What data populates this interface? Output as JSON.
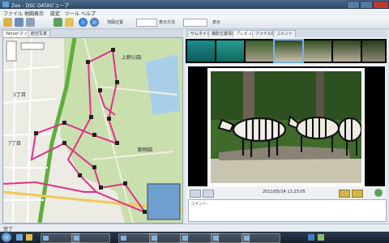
{
  "window": {
    "title": "Zeo - DSC DATAビューア",
    "status_text": "完了"
  },
  "menu": {
    "items": [
      "ファイル",
      "地図表示",
      "設定",
      "ツール",
      "ヘルプ"
    ]
  },
  "toolbar": {
    "buttons": [
      "open-folder",
      "save",
      "print",
      "refresh",
      "globe",
      "globe-alt"
    ],
    "label_a": "地図位置",
    "select_a": "",
    "label_b": "表示方法",
    "select_b": "",
    "label_c": "表示"
  },
  "map": {
    "tabs": [
      "Yahoo!マップ",
      "航空写真"
    ],
    "labels": [
      "上野公園",
      "3丁目",
      "7丁目",
      "動物園"
    ]
  },
  "right": {
    "tabs": [
      "サムネイル",
      "撮影位置情報",
      "プレビュー",
      "ファイル情報",
      "コメント"
    ],
    "timestamp": "2011/05/14 11:23:05"
  },
  "comment": {
    "label": "コメント",
    "value": ""
  },
  "taskbar": {
    "items": [
      "",
      "",
      "",
      "",
      "",
      "",
      ""
    ],
    "clock": ""
  },
  "colors": {
    "route": "#e0318b",
    "park": "#b8d79a",
    "rail": "#5fae3c"
  }
}
